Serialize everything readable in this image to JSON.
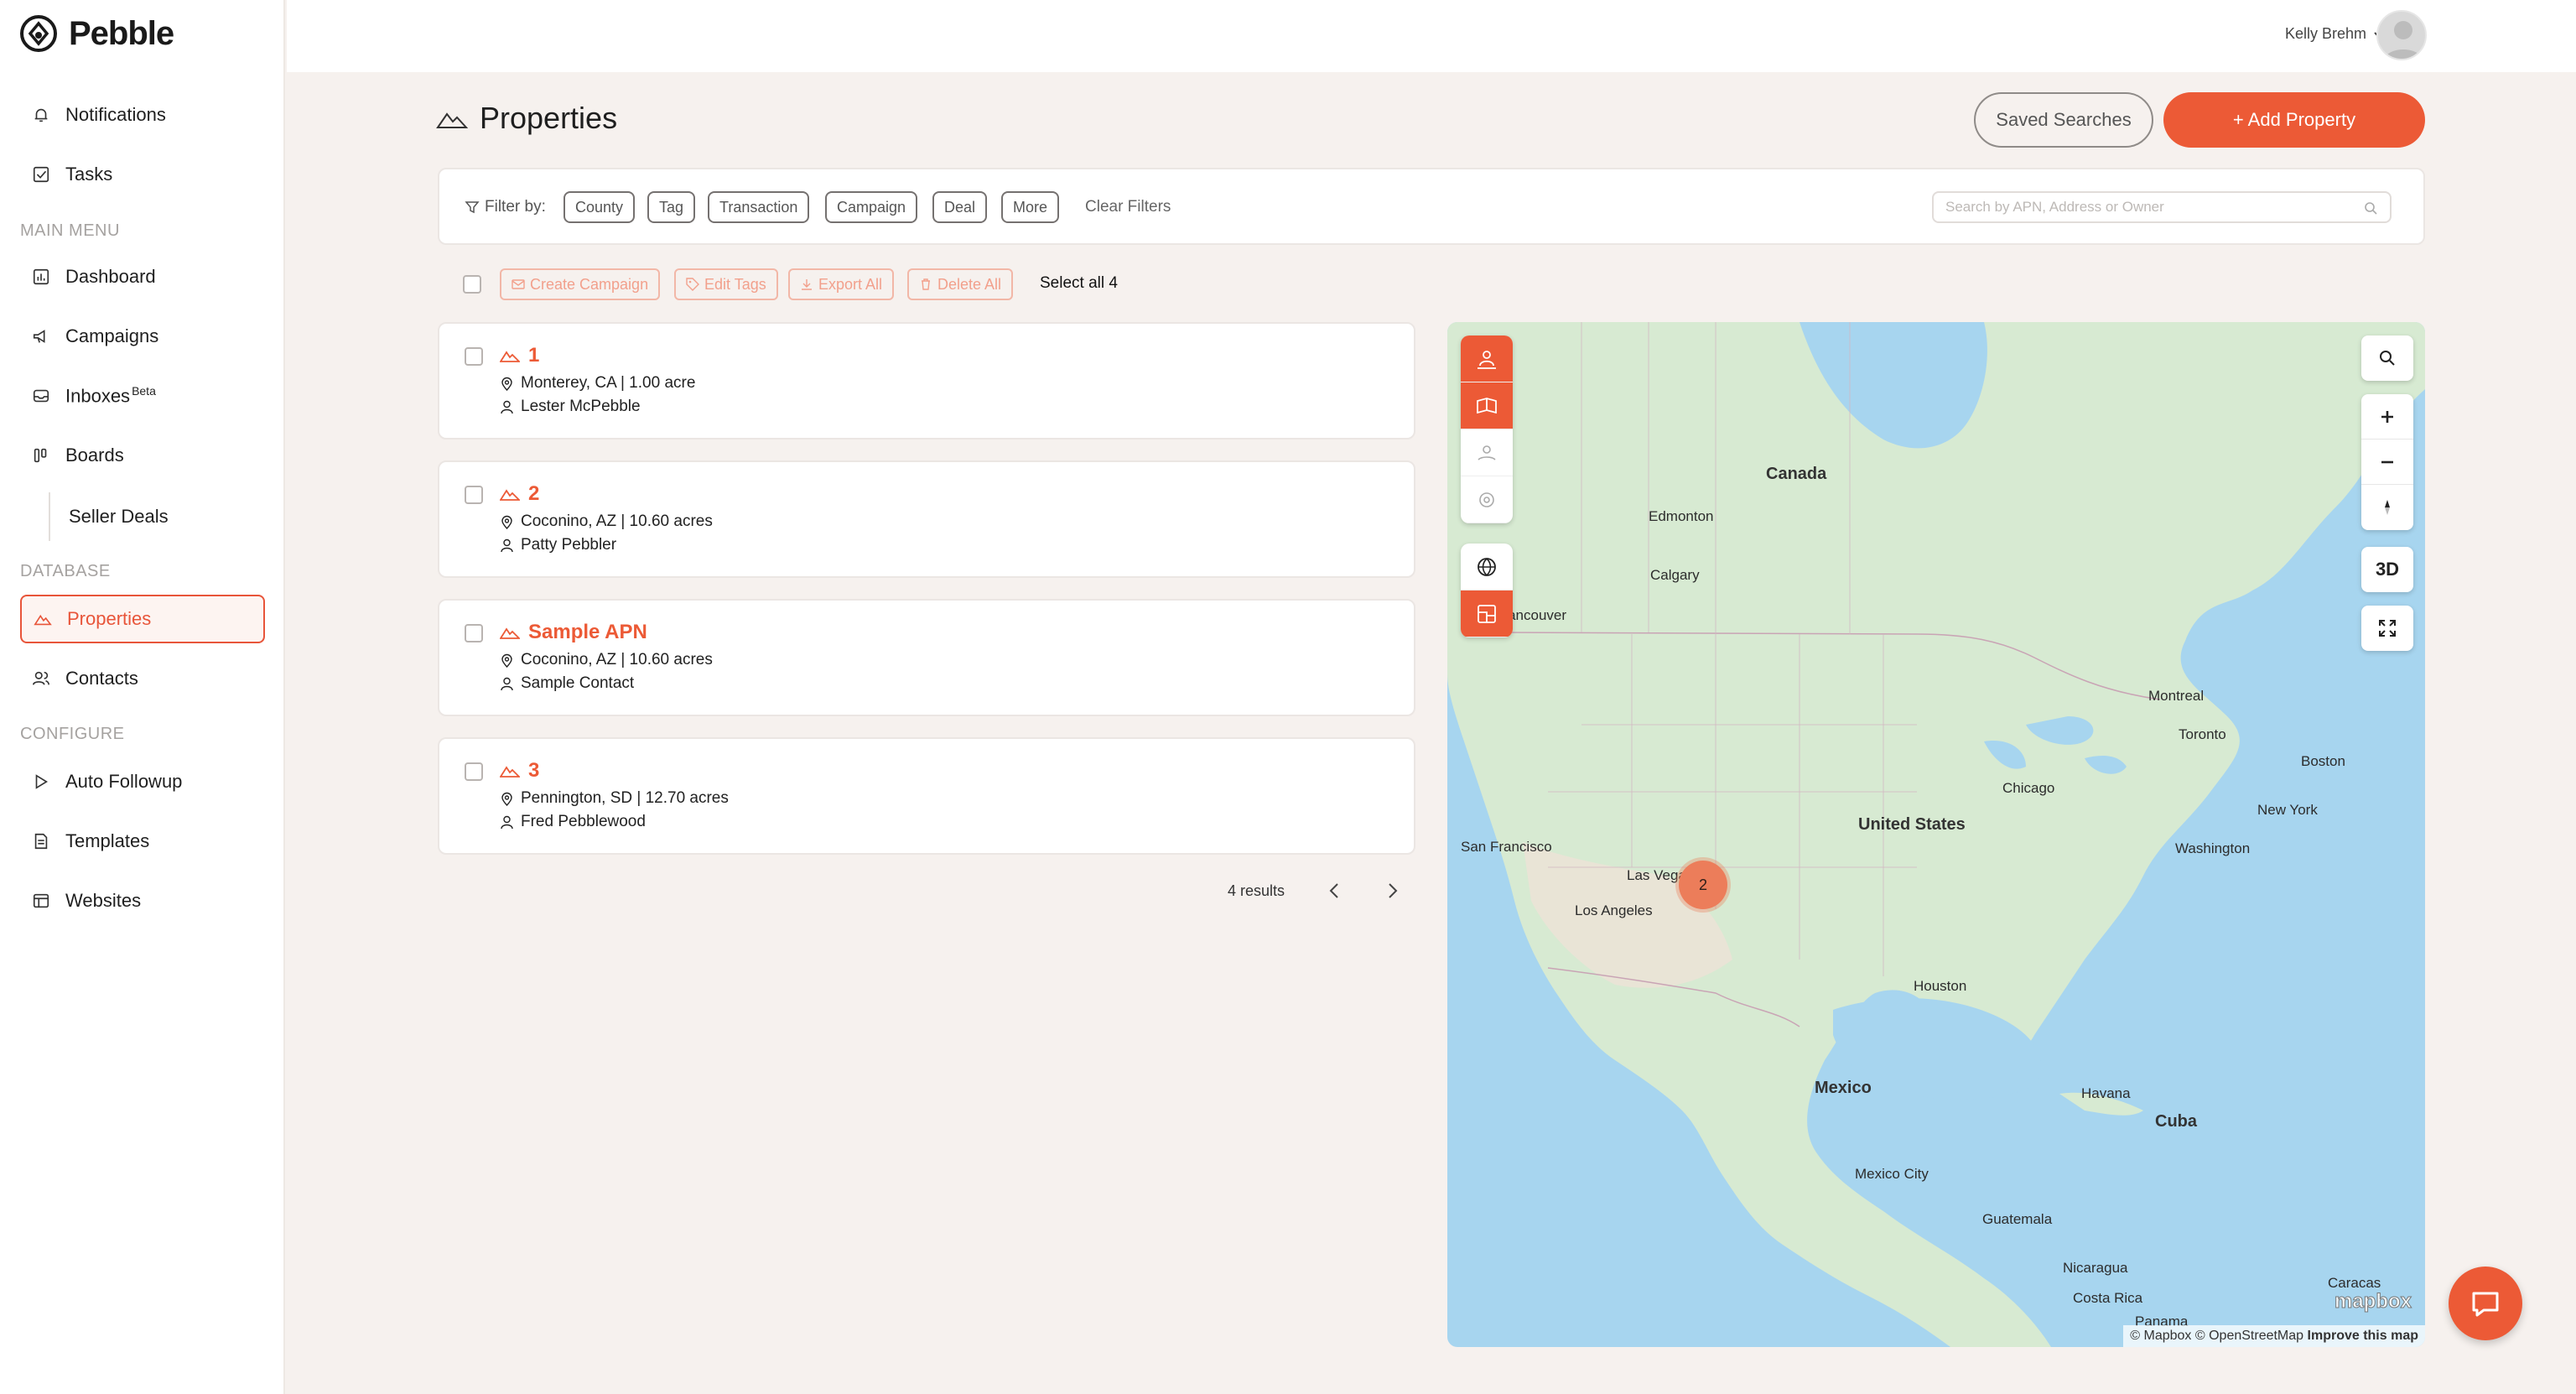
{
  "app": {
    "name": "Pebble"
  },
  "sidebar": {
    "items": [
      {
        "label": "Notifications",
        "icon": "bell-icon"
      },
      {
        "label": "Tasks",
        "icon": "checkbox-icon"
      },
      {
        "label": "Dashboard",
        "icon": "dashboard-icon"
      },
      {
        "label": "Campaigns",
        "icon": "megaphone-icon"
      },
      {
        "label": "Inboxes",
        "badge": "Beta",
        "icon": "inbox-icon"
      },
      {
        "label": "Boards",
        "icon": "boards-icon"
      },
      {
        "label": "Seller Deals"
      },
      {
        "label": "Properties",
        "icon": "mountain-icon",
        "active": true
      },
      {
        "label": "Contacts",
        "icon": "contacts-icon"
      },
      {
        "label": "Auto Followup",
        "icon": "play-icon"
      },
      {
        "label": "Templates",
        "icon": "document-icon"
      },
      {
        "label": "Websites",
        "icon": "website-icon"
      }
    ],
    "sections": {
      "main": "MAIN MENU",
      "database": "DATABASE",
      "configure": "CONFIGURE"
    }
  },
  "header": {
    "user_name": "Kelly Brehm"
  },
  "page": {
    "title": "Properties",
    "saved_searches": "Saved Searches",
    "add_property": "+ Add Property"
  },
  "filters": {
    "label": "Filter by:",
    "chips": [
      "County",
      "Tag",
      "Transaction",
      "Campaign",
      "Deal",
      "More"
    ],
    "clear": "Clear Filters",
    "search_placeholder": "Search by APN, Address or Owner"
  },
  "bulk": {
    "create_campaign": "Create Campaign",
    "edit_tags": "Edit Tags",
    "export_all": "Export All",
    "delete_all": "Delete All",
    "select_all": "Select all 4"
  },
  "properties": [
    {
      "title": "1",
      "location": "Monterey, CA | 1.00 acre",
      "owner": "Lester McPebble"
    },
    {
      "title": "2",
      "location": "Coconino, AZ | 10.60 acres",
      "owner": "Patty Pebbler"
    },
    {
      "title": "Sample APN",
      "location": "Coconino, AZ | 10.60 acres",
      "owner": "Sample Contact"
    },
    {
      "title": "3",
      "location": "Pennington, SD | 12.70 acres",
      "owner": "Fred Pebblewood"
    }
  ],
  "pagination": {
    "results": "4 results"
  },
  "map": {
    "countries": [
      "Canada",
      "United States",
      "Mexico",
      "Cuba"
    ],
    "cities": [
      "Edmonton",
      "Calgary",
      "Vancouver",
      "Montreal",
      "Toronto",
      "Boston",
      "New York",
      "Washington",
      "Chicago",
      "San Francisco",
      "Las Vegas",
      "Los Angeles",
      "Houston",
      "Havana",
      "Mexico City",
      "Guatemala",
      "Nicaragua",
      "Costa Rica",
      "Panama",
      "Caracas"
    ],
    "cluster_count": "2",
    "control_3d": "3D",
    "attribution": "© Mapbox © OpenStreetMap",
    "improve": "Improve this map",
    "logo": "mapbox"
  },
  "colors": {
    "accent": "#ec5a36",
    "background": "#f6f1ee"
  }
}
